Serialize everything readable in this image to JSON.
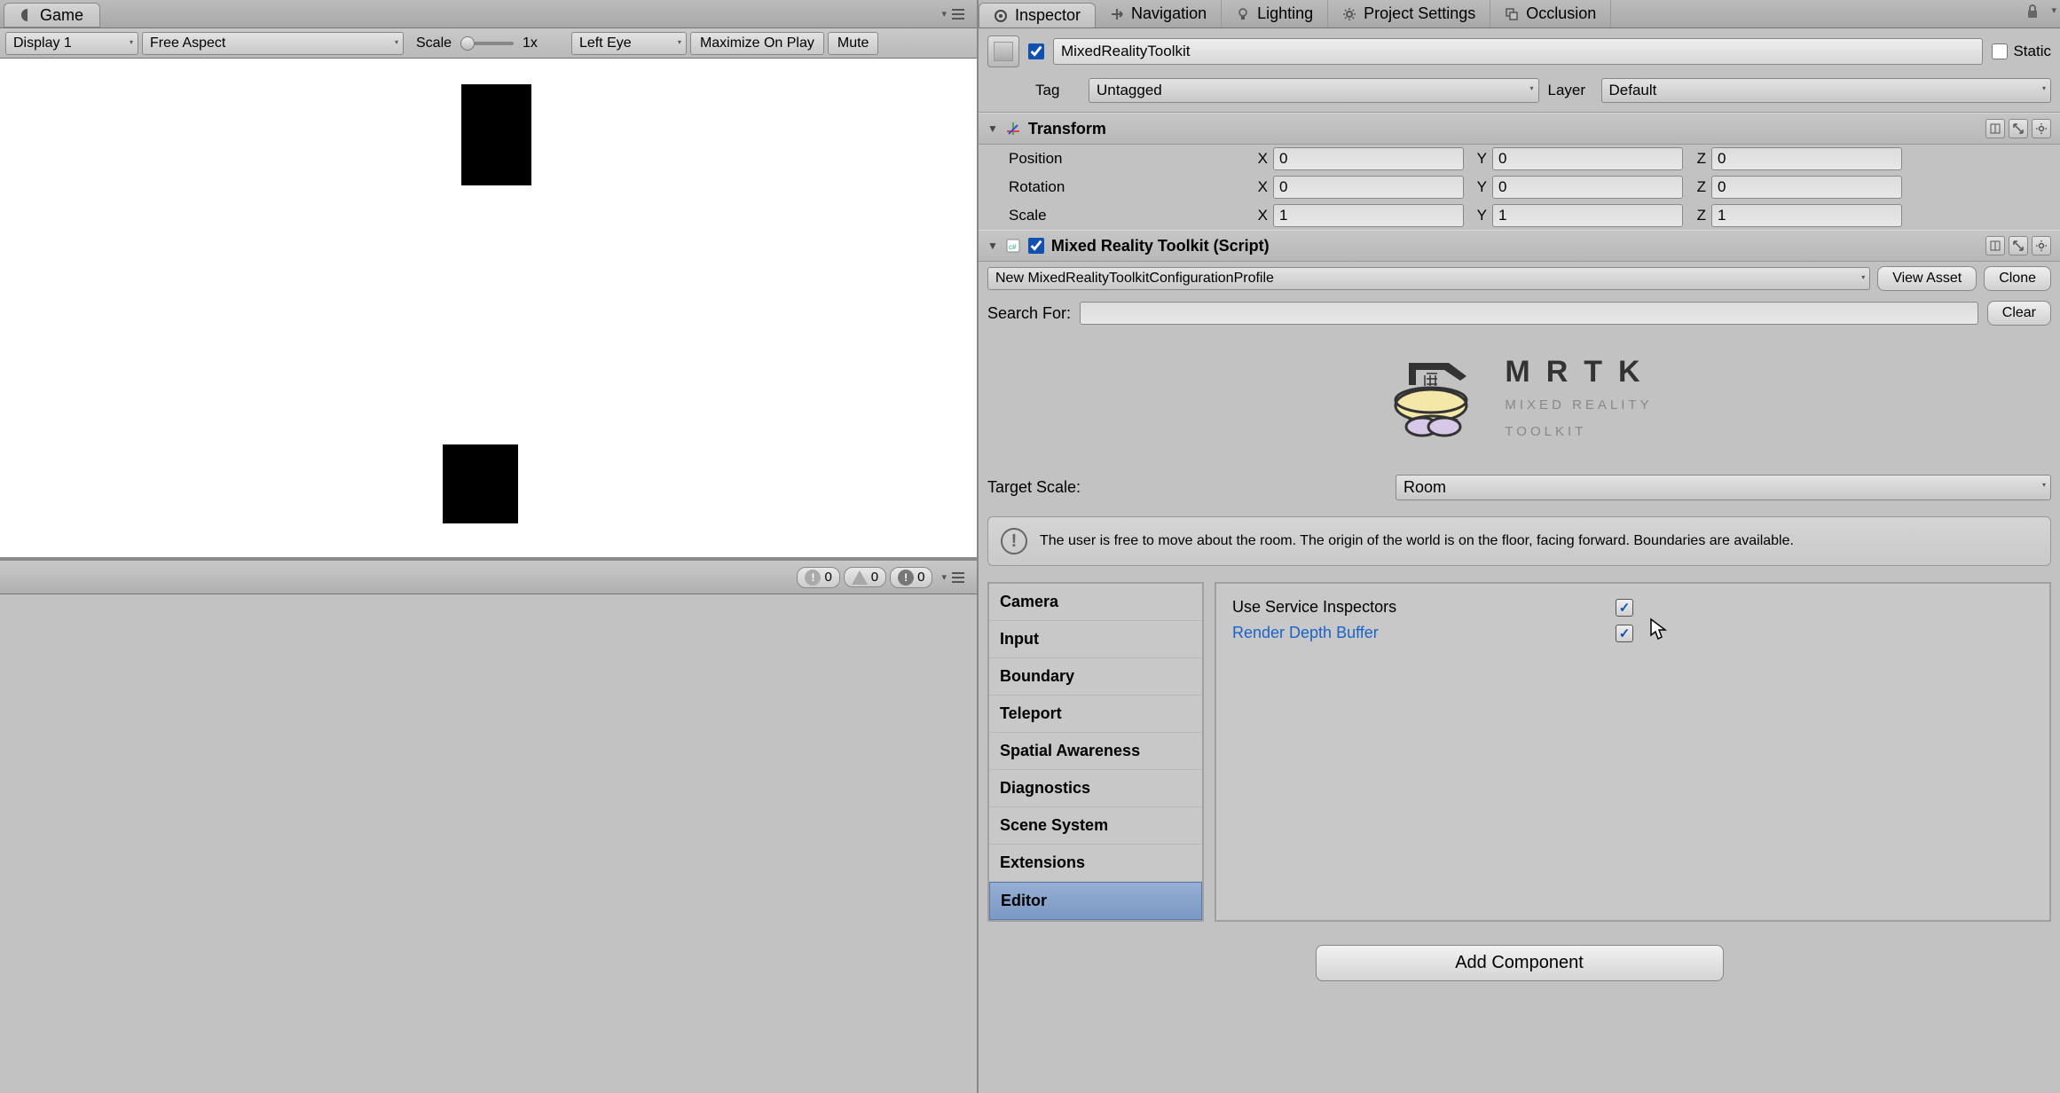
{
  "game": {
    "tab_label": "Game",
    "display": "Display 1",
    "aspect": "Free Aspect",
    "scale_label": "Scale",
    "scale_value": "1x",
    "eye": "Left Eye",
    "maximize": "Maximize On Play",
    "mute": "Mute"
  },
  "console": {
    "info_count": "0",
    "warn_count": "0",
    "error_count": "0"
  },
  "inspector": {
    "tabs": {
      "inspector": "Inspector",
      "navigation": "Navigation",
      "lighting": "Lighting",
      "project_settings": "Project Settings",
      "occlusion": "Occlusion"
    },
    "go_name": "MixedRealityToolkit",
    "static_label": "Static",
    "tag_label": "Tag",
    "tag_value": "Untagged",
    "layer_label": "Layer",
    "layer_value": "Default"
  },
  "transform": {
    "title": "Transform",
    "position_label": "Position",
    "rotation_label": "Rotation",
    "scale_label": "Scale",
    "pos": {
      "x": "0",
      "y": "0",
      "z": "0"
    },
    "rot": {
      "x": "0",
      "y": "0",
      "z": "0"
    },
    "scl": {
      "x": "1",
      "y": "1",
      "z": "1"
    }
  },
  "mrtk_script": {
    "title": "Mixed Reality Toolkit (Script)",
    "profile": "New MixedRealityToolkitConfigurationProfile",
    "view_asset": "View Asset",
    "clone": "Clone",
    "search_label": "Search For:",
    "clear": "Clear"
  },
  "mrtk_logo": {
    "title": "MRTK",
    "sub1": "MIXED REALITY",
    "sub2": "TOOLKIT"
  },
  "target_scale": {
    "label": "Target Scale:",
    "value": "Room"
  },
  "info": "The user is free to move about the room. The origin of the world is on the floor, facing forward. Boundaries are available.",
  "sidebar": {
    "items": [
      "Camera",
      "Input",
      "Boundary",
      "Teleport",
      "Spatial Awareness",
      "Diagnostics",
      "Scene System",
      "Extensions",
      "Editor"
    ],
    "selected": 8
  },
  "editor_content": {
    "use_service_inspectors": "Use Service Inspectors",
    "render_depth_buffer": "Render Depth Buffer"
  },
  "add_component": "Add Component"
}
